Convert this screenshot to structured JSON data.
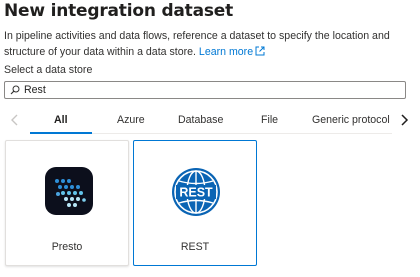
{
  "dialog": {
    "title": "New integration dataset",
    "description": "In pipeline activities and data flows, reference a dataset to specify the location and structure of your data within a data store.",
    "learn_more": "Learn more"
  },
  "select_label": "Select a data store",
  "search": {
    "value": "Rest",
    "icon": "search-icon"
  },
  "tabs": [
    {
      "label": "All",
      "active": true
    },
    {
      "label": "Azure"
    },
    {
      "label": "Database"
    },
    {
      "label": "File"
    },
    {
      "label": "Generic protocol"
    }
  ],
  "cards": [
    {
      "label": "Presto",
      "icon": "presto-logo",
      "selected": false
    },
    {
      "label": "REST",
      "icon": "rest-logo",
      "selected": true,
      "logo_text": "REST"
    }
  ],
  "colors": {
    "accent": "#0078d4",
    "rest_blue": "#0a64b4",
    "presto_bg": "#0c0f1c"
  }
}
